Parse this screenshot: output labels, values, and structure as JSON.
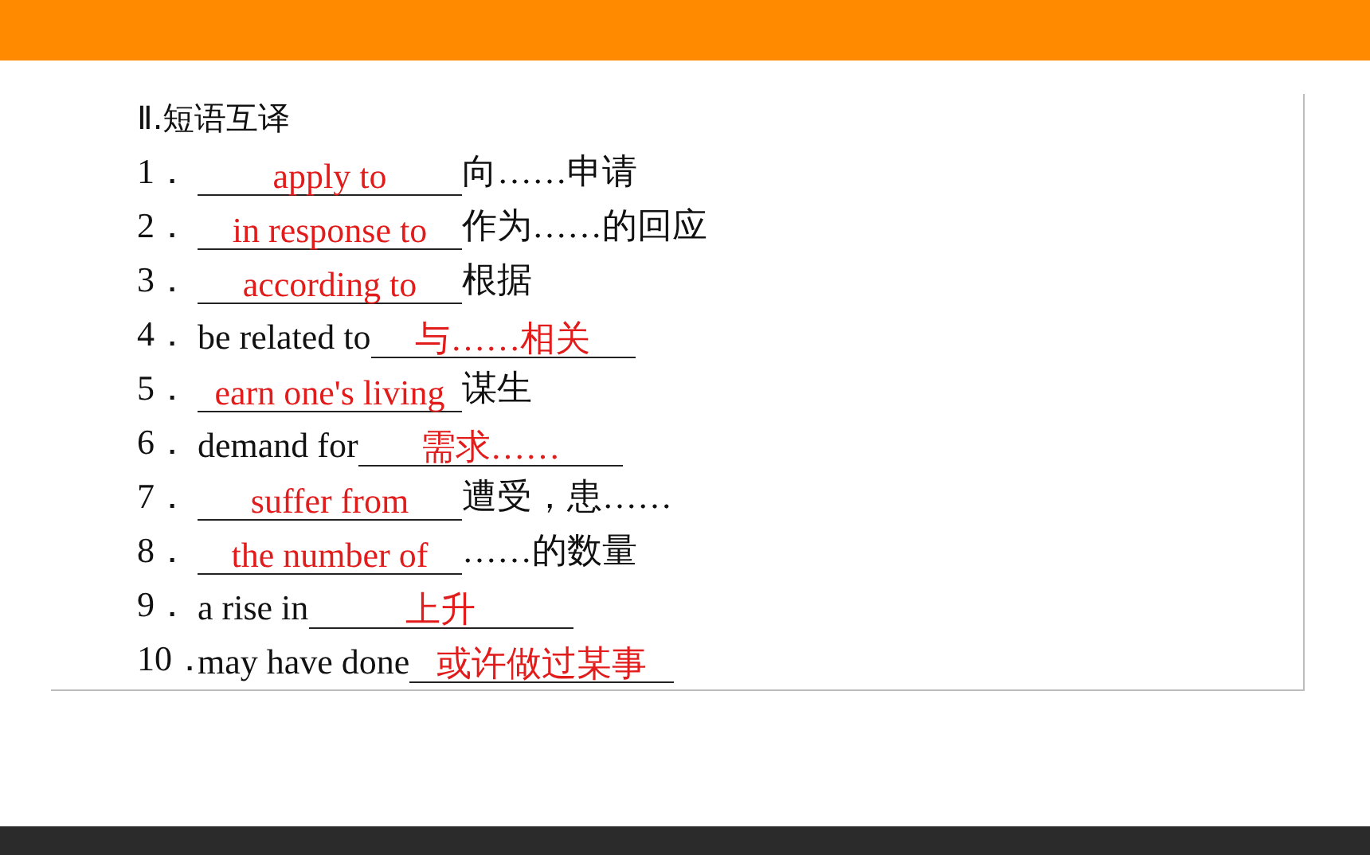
{
  "heading": "Ⅱ.短语互译",
  "items": [
    {
      "number": "1．",
      "answer": "apply to",
      "suffix": "向……申请"
    },
    {
      "number": "2．",
      "answer": "in response to",
      "suffix": "作为……的回应"
    },
    {
      "number": "3．",
      "answer": "according to",
      "suffix": "根据"
    },
    {
      "number": "4．",
      "prompt": "be related to",
      "answer": "与……相关"
    },
    {
      "number": "5．",
      "answer": "earn one's living",
      "suffix": "谋生"
    },
    {
      "number": "6．",
      "prompt": "demand for",
      "answer": "需求……"
    },
    {
      "number": "7．",
      "answer": "suffer from",
      "suffix": "遭受，患……"
    },
    {
      "number": "8．",
      "answer": "the number of",
      "suffix": "……的数量"
    },
    {
      "number": "9．",
      "prompt": "a rise in",
      "answer": "上升"
    },
    {
      "number": "10．",
      "prompt": "may have done",
      "answer": "或许做过某事"
    }
  ]
}
